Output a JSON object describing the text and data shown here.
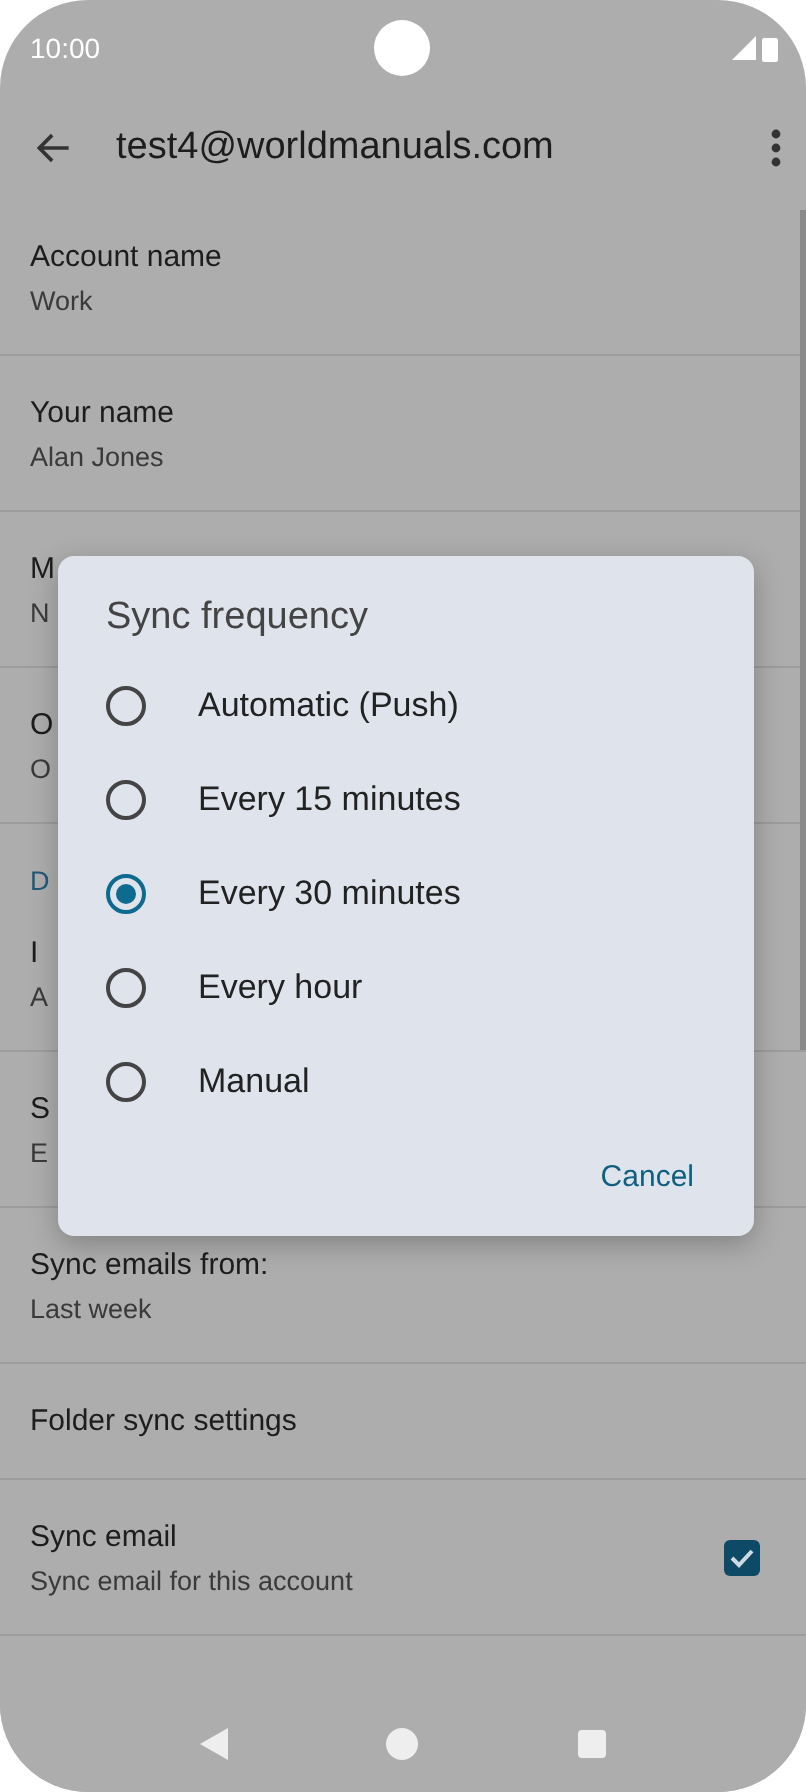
{
  "status_bar": {
    "time": "10:00"
  },
  "app_bar": {
    "title": "test4@worldmanuals.com"
  },
  "rows": [
    {
      "kind": "item",
      "title": "Account name",
      "value": "Work"
    },
    {
      "kind": "item",
      "title": "Your name",
      "value": "Alan Jones"
    },
    {
      "kind": "item",
      "title": "M",
      "value": "N"
    },
    {
      "kind": "item",
      "title": "O",
      "value": "O"
    },
    {
      "kind": "header",
      "title": "D"
    },
    {
      "kind": "item",
      "title": "I",
      "value": "A"
    },
    {
      "kind": "item",
      "title": "S",
      "value": "E"
    },
    {
      "kind": "item",
      "title": "Sync emails from:",
      "value": "Last week"
    },
    {
      "kind": "item",
      "title": "Folder sync settings"
    },
    {
      "kind": "check",
      "title": "Sync email",
      "value": "Sync email for this account",
      "checked": true
    }
  ],
  "dialog": {
    "title": "Sync frequency",
    "options": [
      {
        "label": "Automatic (Push)",
        "selected": false
      },
      {
        "label": "Every 15 minutes",
        "selected": false
      },
      {
        "label": "Every 30 minutes",
        "selected": true
      },
      {
        "label": "Every hour",
        "selected": false
      },
      {
        "label": "Manual",
        "selected": false
      }
    ],
    "button": "Cancel"
  }
}
